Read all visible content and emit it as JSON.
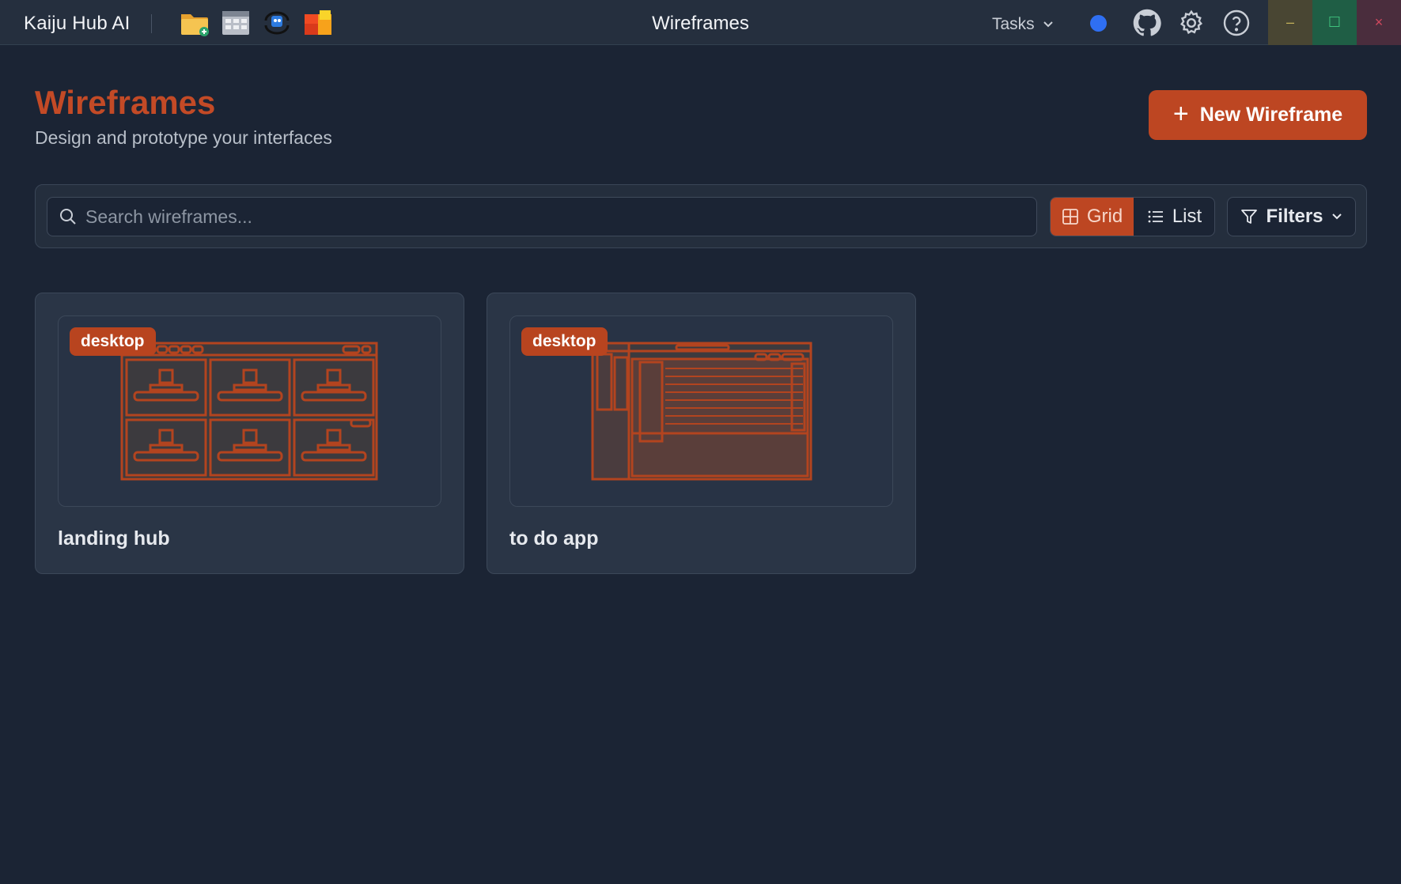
{
  "titlebar": {
    "app_name": "Kaiju Hub AI",
    "window_title": "Wireframes",
    "quick_icons": [
      "folder-add-icon",
      "grid-app-icon",
      "sync-bot-icon",
      "color-blocks-icon"
    ],
    "tasks_label": "Tasks",
    "status_color": "#2f6ff2",
    "icons": [
      "github-icon",
      "gear-icon",
      "help-icon"
    ],
    "window_controls": {
      "minimize": "–",
      "maximize": "☐",
      "close": "×"
    }
  },
  "header": {
    "title": "Wireframes",
    "subtitle": "Design and prototype your interfaces",
    "new_button_label": "New Wireframe"
  },
  "toolbar": {
    "search_placeholder": "Search wireframes...",
    "search_value": "",
    "view_grid_label": "Grid",
    "view_list_label": "List",
    "active_view": "Grid",
    "filters_label": "Filters"
  },
  "wireframes": [
    {
      "name": "landing hub",
      "device": "desktop",
      "preview": "grid-layout"
    },
    {
      "name": "to do app",
      "device": "desktop",
      "preview": "list-layout"
    }
  ],
  "colors": {
    "accent": "#bd4622",
    "title_accent": "#c34a26",
    "background": "#1b2434",
    "surface": "#2a3546"
  }
}
